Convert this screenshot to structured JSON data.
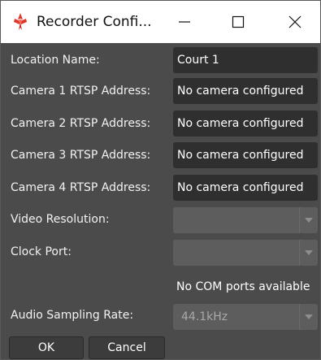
{
  "window": {
    "title": "Recorder Confi...",
    "minimize_icon": "minimize-icon",
    "maximize_icon": "maximize-icon",
    "close_icon": "close-icon"
  },
  "form": {
    "location": {
      "label": "Location Name:",
      "value": "Court 1"
    },
    "camera1": {
      "label": "Camera 1 RTSP Address:",
      "value": "No camera configured"
    },
    "camera2": {
      "label": "Camera 2 RTSP Address:",
      "value": "No camera configured"
    },
    "camera3": {
      "label": "Camera 3 RTSP Address:",
      "value": "No camera configured"
    },
    "camera4": {
      "label": "Camera 4 RTSP Address:",
      "value": "No camera configured"
    },
    "video_resolution": {
      "label": "Video Resolution:",
      "value": ""
    },
    "clock_port": {
      "label": "Clock Port:",
      "value": "",
      "note": "No COM ports available"
    },
    "audio_sampling_rate": {
      "label": "Audio Sampling Rate:",
      "value": "44.1kHz"
    }
  },
  "buttons": {
    "ok": "OK",
    "cancel": "Cancel"
  },
  "colors": {
    "background": "#4b4b4b",
    "field": "#2f2f2f",
    "disabled_select": "#5d5d5d",
    "titlebar": "#ffffff",
    "app_icon_red": "#e2352a"
  }
}
